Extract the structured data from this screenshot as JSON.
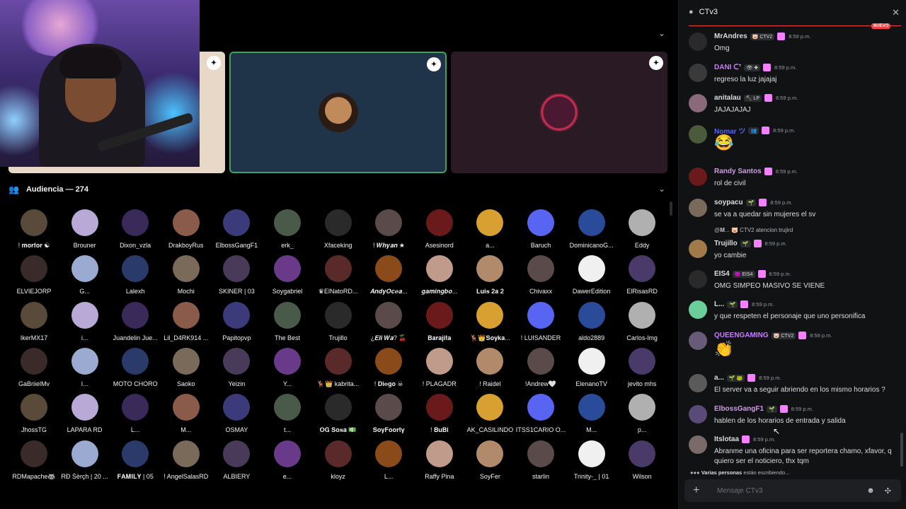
{
  "stage": {
    "collapse_icon": "chevron-down-icon",
    "shield_icon": "shield-icon"
  },
  "audience": {
    "label": "Audiencia — 274",
    "icon": "people-icon",
    "collapse_icon": "chevron-down-icon",
    "members": [
      "! 𝐦𝐨𝐫𝐟𝐨𝐫 ☯",
      "Brouner",
      "Dixon_vzla",
      "DrakboyRus",
      "ElbossGangF1",
      "erk_",
      "Xfaceking",
      "! 𝑾𝒉𝒚𝒂𝒏 ★",
      "Asesinord",
      "a...",
      "Baruch",
      "DominicanoG...",
      "Eddy",
      "ELVIEJORP",
      "G...",
      "Lalexh",
      "Mochi",
      "SKINER | 03",
      "Soygabriel",
      "♛ElNatoRD...",
      "𝑨𝒏𝒅𝒚𝑶𝒄𝒆𝒂...",
      "𝒈𝒂𝒎𝒊𝒏𝒈𝒃𝒐...",
      "𝐋𝐮𝐢𝐬 𝟐𝐚 𝟐",
      "Chivaxx",
      "DawerEdition",
      "ElRisasRD",
      "IkerMX17",
      "i...",
      "Juandelin Jue...",
      "Lil_D4RK914 ...",
      "Papitopvp",
      "The Best",
      "Trujillo",
      "¿𝑬𝒍𝒊 𝑾𝒂? 🍒",
      "𝐁𝐚𝐫𝐚𝐣𝐢𝐭𝐚",
      "🦌👑𝐒𝐨𝐲𝐤𝐚...",
      "! LUISANDER",
      "aldo2889",
      "Carlos-lmg",
      "GaBriielMv",
      "l...",
      "MOTO CHORO",
      "Saoko",
      "Yeizin",
      "Y...",
      "🦌👑 kabrita...",
      "! 𝐃𝐢𝐞𝐠𝐨 ☠",
      "! PLAGADR",
      "! Raidel",
      "!Andrew🤍",
      "ElenanoTV",
      "jevito mhs",
      "JhossTG",
      "LAPARA RD",
      "L...",
      "M...",
      "OSMAY",
      "t...",
      "𝐎𝐆 𝐒𝐨𝐬𝐚 💵",
      "𝐒𝐨𝐲𝐅𝐨𝐨𝐫𝐭𝐲",
      "! 𝐁𝐮𝐁𝐢",
      "AK_CASILINDO",
      "ITSS1CARIO O...",
      "M...",
      "p...",
      "RDMapache🦝",
      "RÐ Śèrçh | 20 ...",
      "𝐅𝐀𝐌𝐈𝐋𝐘 | 05",
      "! AngelSalasRD",
      "ALBIERY",
      "e...",
      "kloyz",
      "L...",
      "Raffy Pina",
      "SoyFer",
      "starlin",
      "Trinity-_ | 01",
      "Wilson"
    ]
  },
  "chat": {
    "title": "CTv3",
    "close_icon": "close-icon",
    "new_label": "NUEVO",
    "messages": [
      {
        "user": "MrAndres",
        "tag": "🐷 CTV2",
        "time": "8:59 p.m.",
        "text": "Omg"
      },
      {
        "user": "DANI ᑕᐪ",
        "tag": "👁 ✚",
        "time": "8:59 p.m.",
        "text": "regreso la luz jajajaj"
      },
      {
        "user": "anitalau",
        "tag": "🔨 LP",
        "time": "8:59 p.m.",
        "text": "JAJAJAJAJ"
      },
      {
        "user": "Nomar ツ",
        "tag": "👥",
        "time": "8:59 p.m.",
        "text": "😂"
      },
      {
        "user": "Randy Santos",
        "tag": "",
        "time": "8:59 p.m.",
        "text": "rol de civil"
      },
      {
        "user": "soypacu",
        "tag": "🌱",
        "time": "8:59 p.m.",
        "text": "se va a quedar sin mujeres el sv"
      },
      {
        "user": "Trujillo",
        "tag": "🌱",
        "time": "8:59 p.m.",
        "text": "yo cambie",
        "reply": "@𝐌... 🐷 CTV2  atencion trujird"
      },
      {
        "user": "EIS4",
        "tag": "😈 EIS4",
        "time": "8:59 p.m.",
        "text": "OMG SIMPEO MASIVO SE VIENE"
      },
      {
        "user": "L...",
        "tag": "🌱",
        "time": "8:59 p.m.",
        "text": "y que respeten el personaje que uno personifica"
      },
      {
        "user": "QUEENGAMING",
        "tag": "🐷 CTV2",
        "time": "8:59 p.m.",
        "text": "👏"
      },
      {
        "user": "a...",
        "tag": "🌱 🐸",
        "time": "8:59 p.m.",
        "text": "El server va a seguir abriendo en los mismo horarios ?"
      },
      {
        "user": "ElbossGangF1",
        "tag": "🌱",
        "time": "8:59 p.m.",
        "text": "hablen de los horarios de entrada y  salida"
      },
      {
        "user": "Itslotaa",
        "tag": "",
        "time": "8:59 p.m.",
        "text": "Abranme una oficina para ser reportera chamo, xfavor, q quiero ser el noticiero, thx tqm"
      }
    ],
    "typing_user": "Varias personas",
    "typing_text": "están escribiendo...",
    "composer_placeholder": "Mensaje CTv3"
  },
  "colors": {
    "accent": "#5865f2",
    "online": "#23a559",
    "new": "#f23f43"
  }
}
